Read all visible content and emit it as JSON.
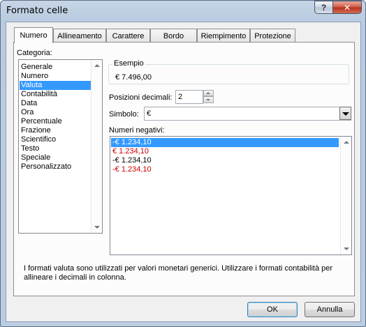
{
  "window": {
    "title": "Formato celle",
    "help_label": "?",
    "close_label": "✕"
  },
  "tabs": [
    {
      "label": "Numero",
      "active": true
    },
    {
      "label": "Allineamento",
      "active": false
    },
    {
      "label": "Carattere",
      "active": false
    },
    {
      "label": "Bordo",
      "active": false
    },
    {
      "label": "Riempimento",
      "active": false
    },
    {
      "label": "Protezione",
      "active": false
    }
  ],
  "category": {
    "label": "Categoria:",
    "items": [
      "Generale",
      "Numero",
      "Valuta",
      "Contabilità",
      "Data",
      "Ora",
      "Percentuale",
      "Frazione",
      "Scientifico",
      "Testo",
      "Speciale",
      "Personalizzato"
    ],
    "selected": "Valuta"
  },
  "sample": {
    "label": "Esempio",
    "value": "€ 7.496,00"
  },
  "decimals": {
    "label": "Posizioni decimali:",
    "value": "2"
  },
  "symbol": {
    "label": "Simbolo:",
    "value": "€"
  },
  "negative": {
    "label": "Numeri negativi:",
    "items": [
      {
        "text": "-€ 1.234,10",
        "color": "#000000",
        "selected": true
      },
      {
        "text": "€ 1.234,10",
        "color": "#cc0000",
        "selected": false
      },
      {
        "text": "-€ 1.234,10",
        "color": "#000000",
        "selected": false
      },
      {
        "text": "-€ 1.234,10",
        "color": "#cc0000",
        "selected": false
      }
    ]
  },
  "description": "I formati valuta sono utilizzati per valori monetari generici. Utilizzare i formati contabilità per allineare i decimali in colonna.",
  "buttons": {
    "ok": "OK",
    "cancel": "Annulla"
  },
  "colors": {
    "selection": "#3399ff",
    "negative_red": "#cc0000"
  }
}
